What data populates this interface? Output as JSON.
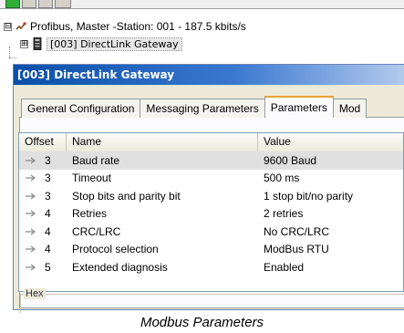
{
  "tree": {
    "root_label": "Profibus, Master -Station: 001 - 187.5 kbits/s",
    "child_label": "[003] DirectLink Gateway",
    "expander_symbol": "⊟",
    "child_expander_symbol": "⊞"
  },
  "dialog": {
    "title": "[003] DirectLink Gateway",
    "tabs": [
      {
        "label": "General Configuration"
      },
      {
        "label": "Messaging Parameters"
      },
      {
        "label": "Parameters"
      },
      {
        "label": "Mod"
      }
    ],
    "active_tab": "Parameters",
    "table": {
      "headers": [
        "Offset",
        "Name",
        "Value"
      ],
      "rows": [
        {
          "offset": "3",
          "name": "Baud rate",
          "value": "9600 Baud"
        },
        {
          "offset": "3",
          "name": "Timeout",
          "value": "500 ms"
        },
        {
          "offset": "3",
          "name": "Stop bits and parity bit",
          "value": "1 stop bit/no parity"
        },
        {
          "offset": "4",
          "name": "Retries",
          "value": "2 retries"
        },
        {
          "offset": "4",
          "name": "CRC/LRC",
          "value": "No CRC/LRC"
        },
        {
          "offset": "4",
          "name": "Protocol selection",
          "value": "ModBus RTU"
        },
        {
          "offset": "5",
          "name": "Extended diagnosis",
          "value": "Enabled"
        }
      ]
    },
    "hex_label": "Hex"
  },
  "caption": "Modbus Parameters",
  "colors": {
    "title_bar": "#0a4fa8",
    "active_tab_accent": "#e8a337",
    "selected_row": "#e0e0e0"
  }
}
